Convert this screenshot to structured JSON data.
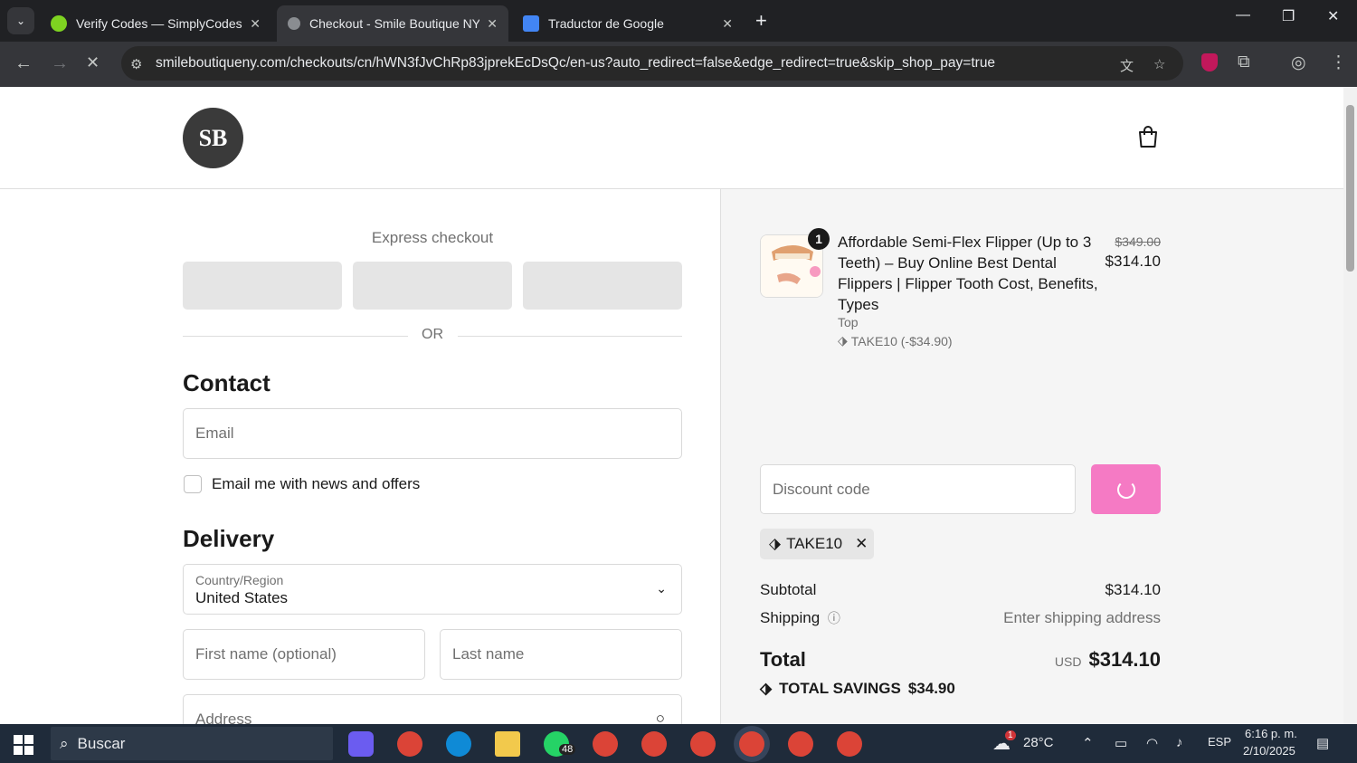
{
  "browser": {
    "tabs": [
      {
        "title": "Verify Codes — SimplyCodes",
        "active": false
      },
      {
        "title": "Checkout - Smile Boutique NY",
        "active": true
      },
      {
        "title": "Traductor de Google",
        "active": false
      }
    ],
    "url": "smileboutiqueny.com/checkouts/cn/hWN3fJvChRp83jprekEcDsQc/en-us?auto_redirect=false&edge_redirect=true&skip_shop_pay=true"
  },
  "store": {
    "logo_text": "SB"
  },
  "checkout": {
    "express_label": "Express checkout",
    "or_label": "OR",
    "contact_heading": "Contact",
    "email_placeholder": "Email",
    "newsletter_label": "Email me with news and offers",
    "delivery_heading": "Delivery",
    "country_label": "Country/Region",
    "country_value": "United States",
    "first_name_placeholder": "First name (optional)",
    "last_name_placeholder": "Last name",
    "address_placeholder": "Address"
  },
  "summary": {
    "product": {
      "quantity": "1",
      "name": "Affordable Semi-Flex Flipper (Up to 3 Teeth) – Buy Online Best Dental Flippers | Flipper Tooth Cost, Benefits, Types",
      "variant": "Top",
      "discount": "TAKE10 (-$34.90)",
      "original_price": "$349.00",
      "price": "$314.10"
    },
    "discount_placeholder": "Discount code",
    "applied_code": "TAKE10",
    "subtotal_label": "Subtotal",
    "subtotal_value": "$314.10",
    "shipping_label": "Shipping",
    "shipping_value": "Enter shipping address",
    "total_label": "Total",
    "currency": "USD",
    "total_value": "$314.10",
    "savings_label": "TOTAL SAVINGS",
    "savings_value": "$34.90"
  },
  "taskbar": {
    "search_label": "Buscar",
    "whatsapp_badge": "48",
    "weather_badge": "1",
    "temperature": "28°C",
    "language": "ESP",
    "time": "6:16 p. m.",
    "date": "2/10/2025"
  },
  "colors": {
    "accent": "#f57ac4",
    "tabbar": "#202124",
    "taskbar": "#1f2b3a"
  }
}
